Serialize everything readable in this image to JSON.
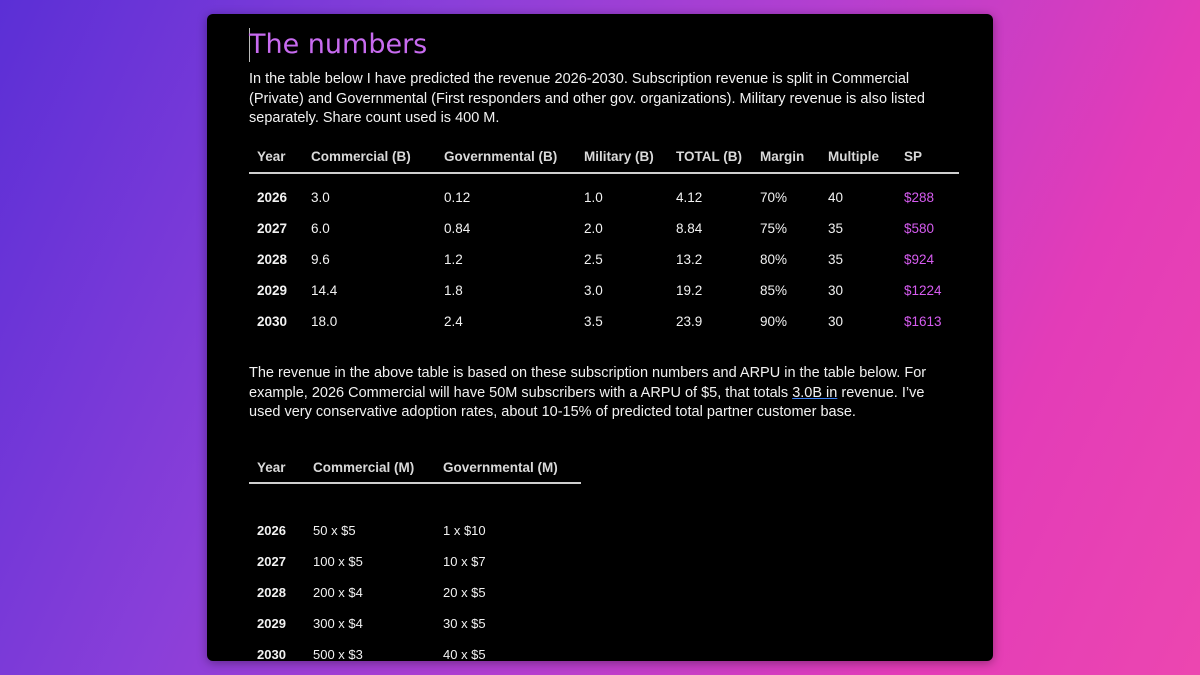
{
  "title": "The numbers",
  "intro": "In the table below I have predicted the revenue 2026-2030. Subscription revenue is split in Commercial (Private) and Governmental (First responders and other gov. organizations). Military revenue is also listed separately. Share count used is 400 M.",
  "revenue_table": {
    "headers": [
      "Year",
      "Commercial (B)",
      "Governmental (B)",
      "Military (B)",
      "TOTAL (B)",
      "Margin",
      "Multiple",
      "SP"
    ],
    "rows": [
      [
        "2026",
        "3.0",
        "0.12",
        "1.0",
        "4.12",
        "70%",
        "40",
        "$288"
      ],
      [
        "2027",
        "6.0",
        "0.84",
        "2.0",
        "8.84",
        "75%",
        "35",
        "$580"
      ],
      [
        "2028",
        "9.6",
        "1.2",
        "2.5",
        "13.2",
        "80%",
        "35",
        "$924"
      ],
      [
        "2029",
        "14.4",
        "1.8",
        "3.0",
        "19.2",
        "85%",
        "30",
        "$1224"
      ],
      [
        "2030",
        "18.0",
        "2.4",
        "3.5",
        "23.9",
        "90%",
        "30",
        "$1613"
      ]
    ]
  },
  "second_para": {
    "before": "The revenue in the above table is based on these subscription numbers and ARPU in the table below. For example, 2026 Commercial will have 50M subscribers with a ARPU of $5, that totals ",
    "underlined": "3.0B  in",
    "after": " revenue. I’ve used very conservative adoption rates, about 10-15% of predicted total partner customer base."
  },
  "subscription_table": {
    "headers": [
      "Year",
      "Commercial (M)",
      "Governmental (M)"
    ],
    "rows": [
      [
        "2026",
        "50 x $5",
        "1 x $10"
      ],
      [
        "2027",
        "100 x $5",
        "10 x $7"
      ],
      [
        "2028",
        "200 x $4",
        "20 x $5"
      ],
      [
        "2029",
        "300 x $4",
        "30 x $5"
      ],
      [
        "2030",
        "500 x $3",
        "40 x $5"
      ]
    ]
  },
  "colors": {
    "title": "#c86bf0",
    "sp_values": "#d65cf0",
    "background": "#000000"
  }
}
